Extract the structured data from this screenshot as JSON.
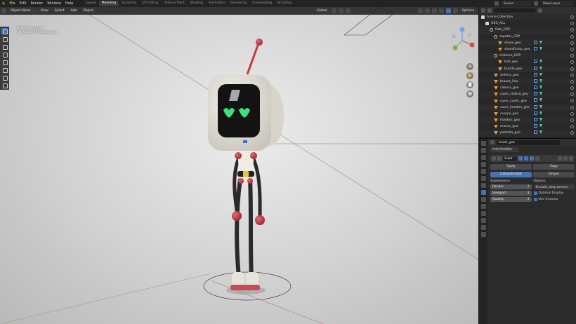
{
  "menu": [
    "File",
    "Edit",
    "Render",
    "Window",
    "Help"
  ],
  "workspaces": [
    "Layout",
    "Modeling",
    "Sculpting",
    "UV Editing",
    "Texture Paint",
    "Shading",
    "Animation",
    "Rendering",
    "Compositing",
    "Scripting"
  ],
  "active_workspace_index": 1,
  "scene_label": "Scene",
  "view_layer_label": "View Layer",
  "viewport": {
    "mode": "Object Mode",
    "menus": [
      "View",
      "Select",
      "Add",
      "Object"
    ],
    "orientation": "Global",
    "options": "Options",
    "info_line1": "User Perspective",
    "info_line2": "(1) Robi_GRP | boots_geo"
  },
  "outliner": {
    "rows": [
      {
        "label": "Scene Collection",
        "icon": "collection",
        "indent": 0
      },
      {
        "label": "GEO_ALL",
        "icon": "collection",
        "indent": 1
      },
      {
        "label": "Robi_GRP",
        "icon": "empty",
        "indent": 2
      },
      {
        "label": "zapatos_GRP",
        "icon": "empty",
        "indent": 3
      },
      {
        "label": "shoes_geo",
        "icon": "mesh",
        "indent": 4
      },
      {
        "label": "shoesRump_geo",
        "icon": "mesh",
        "indent": 4
      },
      {
        "label": "cinturon_GRP",
        "icon": "empty",
        "indent": 3
      },
      {
        "label": "belt_geo",
        "icon": "mesh",
        "indent": 4
      },
      {
        "label": "buckle_geo",
        "icon": "mesh",
        "indent": 4
      },
      {
        "label": "antena_geo",
        "icon": "mesh",
        "indent": 3
      },
      {
        "label": "brazos_line",
        "icon": "mesh",
        "indent": 3
      },
      {
        "label": "cabeza_geo",
        "icon": "mesh",
        "indent": 3
      },
      {
        "label": "cuerr_cadera_geo",
        "icon": "mesh",
        "indent": 3
      },
      {
        "label": "cuerr_cuello_geo",
        "icon": "mesh",
        "indent": 3
      },
      {
        "label": "cuerr_hombro_geo",
        "icon": "mesh",
        "indent": 3
      },
      {
        "label": "cuerpo_geo",
        "icon": "mesh",
        "indent": 3
      },
      {
        "label": "hombro_geo",
        "icon": "mesh",
        "indent": 3
      },
      {
        "label": "manos_geo",
        "icon": "mesh",
        "indent": 3
      },
      {
        "label": "pantalla_geo",
        "icon": "mesh",
        "indent": 3
      }
    ]
  },
  "properties": {
    "object_name": "boots_geo",
    "add_modifier": "Add Modifier",
    "modifier_name": "Subd",
    "apply": "Apply",
    "copy": "Copy",
    "subdiv_type_selected": "Catmull-Clark",
    "subdiv_type_other": "Simple",
    "subdivisions_label": "Subdivisions",
    "options_label": "Options",
    "render_label": "Render",
    "render_value": "3",
    "viewport_label": "Viewport",
    "viewport_value": "3",
    "quality_label": "Quality",
    "quality_value": "3",
    "uv_smooth": "Smooth, keep corners",
    "optimal_display": "Optimal Display",
    "use_creases": "Use Creases"
  }
}
